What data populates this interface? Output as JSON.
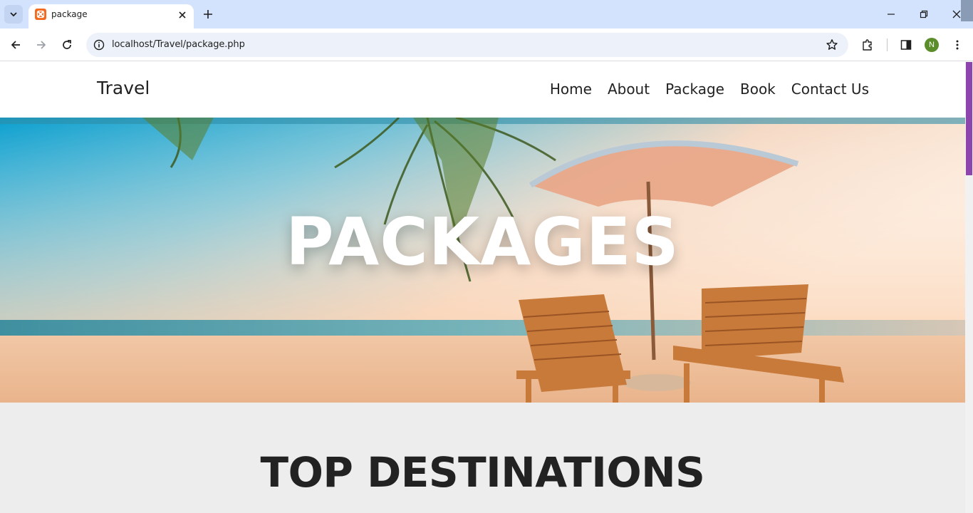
{
  "browser": {
    "tab_title": "package",
    "url": "localhost/Travel/package.php",
    "profile_initial": "N"
  },
  "site": {
    "logo": "Travel",
    "nav": [
      "Home",
      "About",
      "Package",
      "Book",
      "Contact Us"
    ]
  },
  "hero": {
    "title": "PACKAGES"
  },
  "section": {
    "title": "TOP DESTINATIONS"
  },
  "colors": {
    "tabstrip": "#d3e3fd",
    "scroll_thumb": "#8e44ad",
    "favicon": "#f26b21",
    "section_bg": "#ededed"
  },
  "icons": [
    "tab-search-icon",
    "xampp-favicon",
    "close-icon",
    "plus-icon",
    "minimize-icon",
    "restore-icon",
    "back-icon",
    "forward-icon",
    "reload-icon",
    "info-icon",
    "star-icon",
    "extensions-icon",
    "sidepanel-icon",
    "kebab-menu-icon"
  ]
}
